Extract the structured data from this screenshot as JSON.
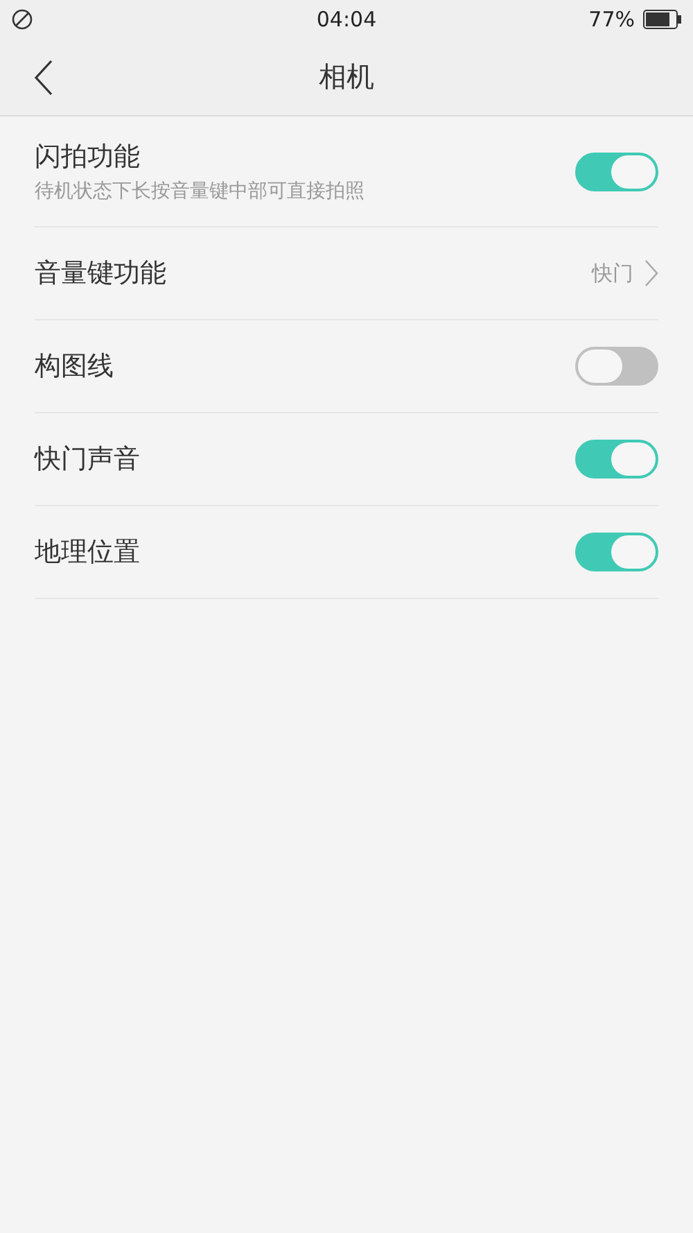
{
  "status_bar": {
    "time": "04:04",
    "battery_text": "77%"
  },
  "header": {
    "title": "相机"
  },
  "settings": [
    {
      "kind": "toggle",
      "label": "闪拍功能",
      "description": "待机状态下长按音量键中部可直接拍照",
      "on": true
    },
    {
      "kind": "link",
      "label": "音量键功能",
      "value": "快门"
    },
    {
      "kind": "toggle",
      "label": "构图线",
      "on": false
    },
    {
      "kind": "toggle",
      "label": "快门声音",
      "on": true
    },
    {
      "kind": "toggle",
      "label": "地理位置",
      "on": true
    }
  ]
}
